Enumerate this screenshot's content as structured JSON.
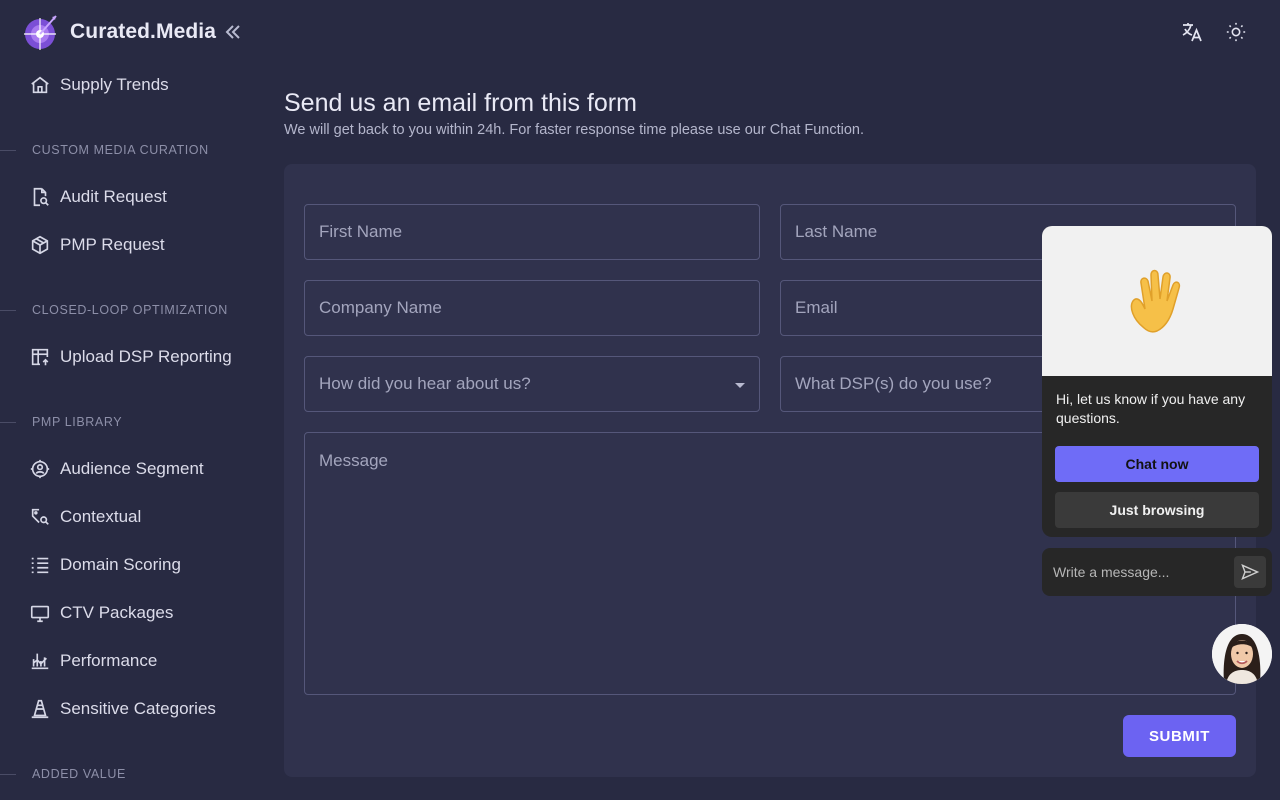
{
  "brand": {
    "name": "Curated.Media"
  },
  "sidebar": {
    "top_item": {
      "label": "Supply Trends",
      "icon": "home-icon"
    },
    "sections": [
      {
        "title": "CUSTOM MEDIA CURATION",
        "items": [
          {
            "label": "Audit Request",
            "icon": "file-search-icon"
          },
          {
            "label": "PMP Request",
            "icon": "package-icon"
          }
        ]
      },
      {
        "title": "CLOSED-LOOP OPTIMIZATION",
        "items": [
          {
            "label": "Upload DSP Reporting",
            "icon": "table-upload-icon"
          }
        ]
      },
      {
        "title": "PMP LIBRARY",
        "items": [
          {
            "label": "Audience Segment",
            "icon": "target-user-icon"
          },
          {
            "label": "Contextual",
            "icon": "tag-search-icon"
          },
          {
            "label": "Domain Scoring",
            "icon": "list-icon"
          },
          {
            "label": "CTV Packages",
            "icon": "tv-icon"
          },
          {
            "label": "Performance",
            "icon": "chart-icon"
          },
          {
            "label": "Sensitive Categories",
            "icon": "cone-icon"
          }
        ]
      },
      {
        "title": "ADDED VALUE",
        "items": []
      }
    ]
  },
  "header": {
    "translate_icon": "translate-icon",
    "theme_icon": "sun-icon"
  },
  "form": {
    "title": "Send us an email from this form",
    "subtitle": "We will get back to you within 24h. For faster response time please use our Chat Function.",
    "first_name_placeholder": "First Name",
    "last_name_placeholder": "Last Name",
    "company_placeholder": "Company Name",
    "email_placeholder": "Email",
    "hear_about_placeholder": "How did you hear about us?",
    "dsp_placeholder": "What DSP(s) do you use?",
    "message_placeholder": "Message",
    "submit_label": "SUBMIT"
  },
  "chat": {
    "greeting": "Hi, let us know if you have any questions.",
    "chat_now_label": "Chat now",
    "just_browsing_label": "Just browsing",
    "input_placeholder": "Write a message..."
  },
  "colors": {
    "accent": "#6c63f2",
    "background": "#282a42",
    "card": "#30324d"
  }
}
